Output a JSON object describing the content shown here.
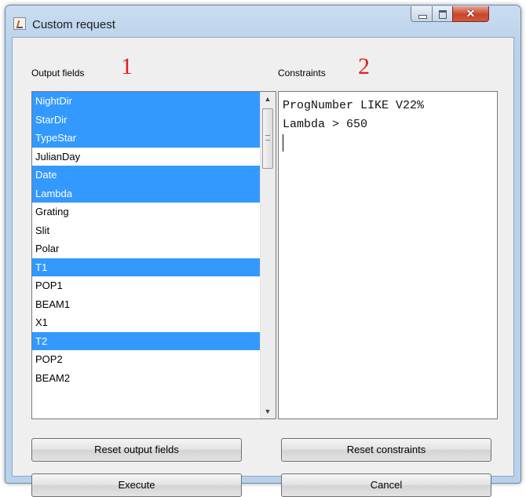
{
  "window": {
    "title": "Custom request"
  },
  "output_fields": {
    "label": "Output fields",
    "number": "1",
    "items": [
      {
        "label": "NightDir",
        "selected": true
      },
      {
        "label": "StarDir",
        "selected": true
      },
      {
        "label": "TypeStar",
        "selected": true
      },
      {
        "label": "JulianDay",
        "selected": false
      },
      {
        "label": "Date",
        "selected": true
      },
      {
        "label": "Lambda",
        "selected": true
      },
      {
        "label": "Grating",
        "selected": false
      },
      {
        "label": "Slit",
        "selected": false
      },
      {
        "label": "Polar",
        "selected": false
      },
      {
        "label": "T1",
        "selected": true
      },
      {
        "label": "POP1",
        "selected": false
      },
      {
        "label": "BEAM1",
        "selected": false
      },
      {
        "label": "X1",
        "selected": false
      },
      {
        "label": "T2",
        "selected": true
      },
      {
        "label": "POP2",
        "selected": false
      },
      {
        "label": "BEAM2",
        "selected": false
      }
    ]
  },
  "constraints": {
    "label": "Constraints",
    "number": "2",
    "lines": [
      "ProgNumber LIKE V22%",
      "Lambda > 650"
    ]
  },
  "buttons": {
    "reset_output": "Reset output fields",
    "reset_constraints": "Reset constraints",
    "execute": "Execute",
    "cancel": "Cancel"
  },
  "colors": {
    "selection": "#3399ff",
    "annotation_number": "#e0201c"
  },
  "icons": {
    "app": "java-cup-icon",
    "minimize": "minimize-icon",
    "maximize": "maximize-icon",
    "close": "close-icon",
    "scroll_up": "arrow-up-icon",
    "scroll_down": "arrow-down-icon"
  }
}
